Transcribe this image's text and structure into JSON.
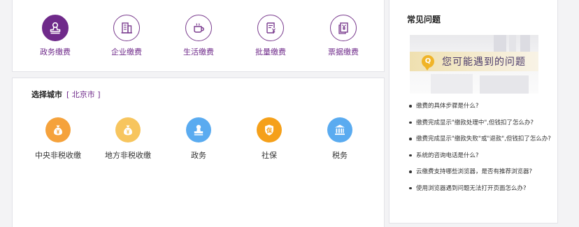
{
  "categories": [
    {
      "label": "政务缴费",
      "icon": "stamp-icon",
      "active": true
    },
    {
      "label": "企业缴费",
      "icon": "building-icon",
      "active": false
    },
    {
      "label": "生活缴费",
      "icon": "coffee-cup-icon",
      "active": false
    },
    {
      "label": "批量缴费",
      "icon": "bill-yen-icon",
      "active": false
    },
    {
      "label": "票据缴费",
      "icon": "receipt-yen-icon",
      "active": false
    }
  ],
  "city": {
    "title": "选择城市",
    "current": "北京市",
    "bracket_open": "[",
    "bracket_close": "]"
  },
  "services": [
    {
      "label": "中央非税收缴",
      "icon": "money-bag-icon",
      "color": "#f5a23c"
    },
    {
      "label": "地方非税收缴",
      "icon": "money-bag-icon",
      "color": "#f7c55e"
    },
    {
      "label": "政务",
      "icon": "stamp-icon",
      "color": "#5aabf0"
    },
    {
      "label": "社保",
      "icon": "shield-icon",
      "color": "#f5a01a"
    },
    {
      "label": "税务",
      "icon": "bank-icon",
      "color": "#5aabf0"
    }
  ],
  "faq": {
    "title": "常见问题",
    "banner_text": "您可能遇到的问题",
    "banner_badge": "Q",
    "items": [
      "缴费的具体步骤是什么?",
      "缴费完成显示\"缴款处理中\",但钱扣了怎么办?",
      "缴费完成显示\"缴款失败\"或\"退款\",但钱扣了怎么办?",
      "系统的咨询电话是什么?",
      "云缴费支持哪些浏览器，是否有推荐浏览器?",
      "使用浏览器遇到问题无法打开页面怎么办?"
    ]
  },
  "colors": {
    "accent": "#6f2a8a"
  }
}
